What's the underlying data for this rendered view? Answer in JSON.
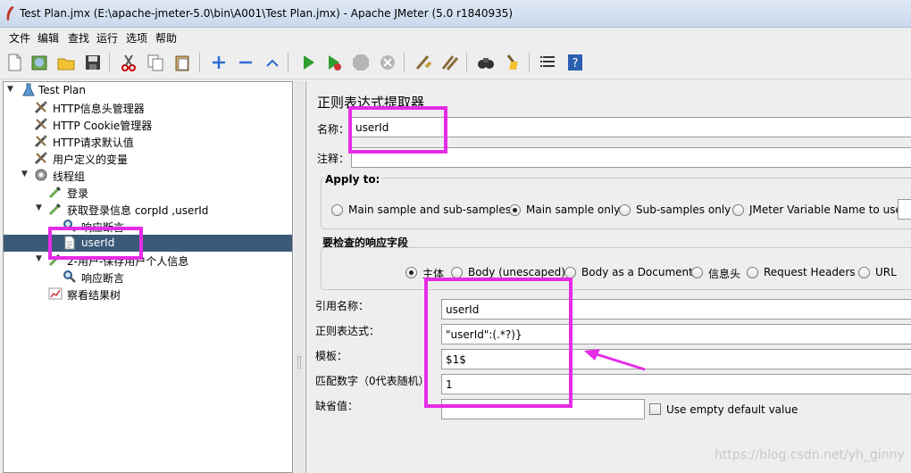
{
  "window": {
    "title": "Test Plan.jmx (E:\\apache-jmeter-5.0\\bin\\A001\\Test Plan.jmx) - Apache JMeter (5.0 r1840935)"
  },
  "menu": [
    "文件",
    "编辑",
    "查找",
    "运行",
    "选项",
    "帮助"
  ],
  "tree": {
    "items": [
      {
        "label": "Test Plan",
        "icon": "flask-icon"
      },
      {
        "label": "HTTP信息头管理器",
        "icon": "wrench-icon"
      },
      {
        "label": "HTTP Cookie管理器",
        "icon": "wrench-icon"
      },
      {
        "label": "HTTP请求默认值",
        "icon": "wrench-icon"
      },
      {
        "label": "用户定义的变量",
        "icon": "wrench-icon"
      },
      {
        "label": "线程组",
        "icon": "gear-icon"
      },
      {
        "label": "登录",
        "icon": "pipette-icon"
      },
      {
        "label": "获取登录信息 corpId ,userId",
        "icon": "pipette-icon"
      },
      {
        "label": "响应断言",
        "icon": "magnifier-icon"
      },
      {
        "label": "userId",
        "icon": "document-icon"
      },
      {
        "label": "2-用户-保存用户个人信息",
        "icon": "pipette-icon"
      },
      {
        "label": "响应断言",
        "icon": "magnifier-icon"
      },
      {
        "label": "察看结果树",
        "icon": "chart-icon"
      }
    ]
  },
  "panel": {
    "title": "正则表达式提取器",
    "name_label": "名称：",
    "name_value": "userId",
    "comment_label": "注释：",
    "comment_value": "",
    "apply_to": {
      "title": "Apply to:",
      "options": [
        "Main sample and sub-samples",
        "Main sample only",
        "Sub-samples only",
        "JMeter Variable Name to use"
      ],
      "selected": "Main sample only"
    },
    "field_check": {
      "title": "要检查的响应字段",
      "options": [
        "主体",
        "Body (unescaped)",
        "Body as a Document",
        "信息头",
        "Request Headers",
        "URL"
      ],
      "selected": "主体"
    },
    "ref_name_label": "引用名称：",
    "ref_name_value": "userId",
    "regex_label": "正则表达式：",
    "regex_value": "\"userId\":(.*?)}",
    "template_label": "模板：",
    "template_value": "$1$",
    "match_no_label": "匹配数字（0代表随机）：",
    "match_no_value": "1",
    "default_label": "缺省值：",
    "default_value": "",
    "use_empty_label": "Use empty default value"
  },
  "watermark": "https://blog.csdn.net/yh_ginny",
  "colors": {
    "highlight": "#e62be6",
    "selection": "#3a5a78"
  }
}
